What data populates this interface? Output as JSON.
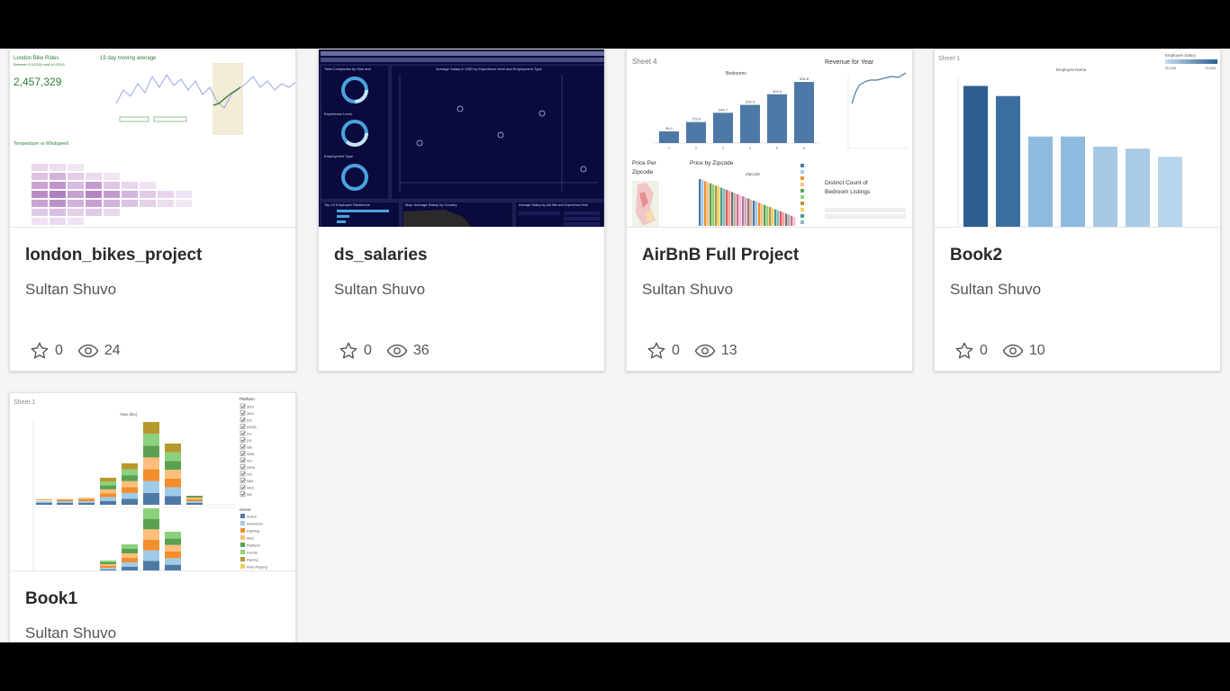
{
  "cards": [
    {
      "title": "london_bikes_project",
      "author": "Sultan Shuvo",
      "favorites": "0",
      "views": "24",
      "thumb": {
        "app_title": "London Bike Rides",
        "app_subtitle": "Between 1/1/2015 and 4/1/2016",
        "big_number": "2,457,329",
        "chart_title": "19 day moving average",
        "section_title": "Temperature vs Windspeed"
      }
    },
    {
      "title": "ds_salaries",
      "author": "Sultan Shuvo",
      "favorites": "0",
      "views": "36",
      "thumb": {
        "panel_a": "Total Companies by Size and",
        "panel_b": "Experience Level",
        "panel_c": "Employment Type",
        "main_title": "Average Salary in USD by Experience level and Employment Type",
        "bottom_a": "Top 10 Employee Residence",
        "bottom_b": "Map: Average Salary by Country",
        "bottom_c": "Average Salary by Job title and Experience level"
      }
    },
    {
      "title": "AirBnB Full Project",
      "author": "Sultan Shuvo",
      "favorites": "0",
      "views": "13",
      "thumb": {
        "sheet": "Sheet 4",
        "bedrooms": "Bedrooms",
        "revenue": "Revenue for Year",
        "price_per": "Price Per",
        "zipcode": "Zipcode",
        "price_by_zip": "Price by Zipcode",
        "zip_label": "Zipcode",
        "distinct": "Distinct Count of",
        "bedroom_listings": "Bedroom Listings",
        "bar_labels": [
          "96.2",
          "173.4",
          "249.7",
          "315.4",
          "403.0",
          "504.8"
        ],
        "bar_values": [
          96.2,
          173.4,
          249.7,
          315.4,
          403.0,
          504.8
        ],
        "x_ticks": [
          "1",
          "2",
          "3",
          "4",
          "5",
          "6"
        ]
      }
    },
    {
      "title": "Book2",
      "author": "Sultan Shuvo",
      "favorites": "0",
      "views": "10",
      "thumb": {
        "sheet": "Sheet 1",
        "legend_title": "Employee Salary",
        "legend_min": "30,000",
        "legend_max": "70,000",
        "chart_title": "Employee Name",
        "bar_values": [
          70,
          65,
          45,
          45,
          40,
          39,
          35
        ]
      }
    },
    {
      "title": "Book1",
      "author": "Sultan Shuvo",
      "favorites": "",
      "views": "",
      "thumb": {
        "sheet": "Sheet 1",
        "year": "Year (bin)",
        "platform": "Platform",
        "genre": "Genre",
        "platforms": [
          "3DO",
          "3DS",
          "DS",
          "DS3D",
          "DC",
          "DS",
          "GB",
          "GBA",
          "GC",
          "GEN",
          "GG",
          "N64",
          "NES",
          "NG"
        ],
        "genres": [
          "Action",
          "Adventure",
          "Fighting",
          "Misc",
          "Platform",
          "Puzzle",
          "Racing",
          "Role-Playing"
        ]
      }
    }
  ],
  "colors": {
    "tableau_blue": "#4e79a7",
    "dark_navy": "#0b0a3c"
  }
}
